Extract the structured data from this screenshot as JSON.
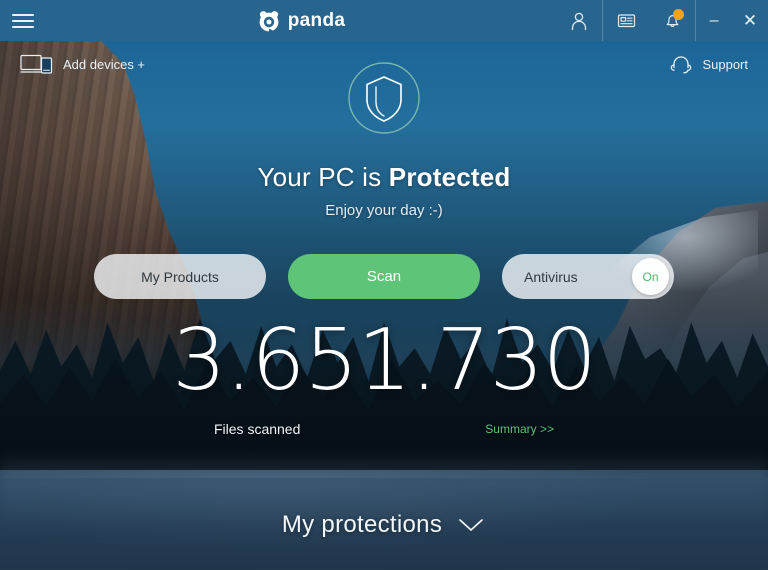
{
  "app": {
    "brand_name": "panda",
    "window_title": "panda"
  },
  "titlebar": {
    "menu_icon": "hamburger-menu-icon",
    "logo_icon": "panda-logo-icon",
    "account_icon": "user-account-icon",
    "news_icon": "news-card-icon",
    "notifications_icon": "notification-bell-icon",
    "notification_badge": "",
    "minimize_label": "–",
    "close_label": "✕",
    "accent_color": "#27658f",
    "badge_color": "#f2a513"
  },
  "toprow": {
    "add_devices_label": "Add devices +",
    "add_devices_icon": "devices-icon",
    "support_label": "Support",
    "support_icon": "headset-support-icon"
  },
  "hero": {
    "shield_icon": "shield-protected-icon",
    "status_prefix": "Your PC is ",
    "status_strong": "Protected",
    "subtitle": "Enjoy your day :-)",
    "shield_ring_color": "#7fb9b0"
  },
  "buttons": {
    "my_products_label": "My Products",
    "scan_label": "Scan",
    "antivirus_label": "Antivirus",
    "antivirus_state": "On",
    "scan_color": "#5ec578",
    "toggle_on_color": "#4eb96a"
  },
  "counter": {
    "files_scanned_value": "3.651.730",
    "files_scanned_label": "Files scanned",
    "summary_link_label": "Summary >>",
    "summary_link_color": "#5ec47a"
  },
  "bottom": {
    "protections_label": "My protections",
    "chevron_icon": "chevron-down-icon"
  }
}
